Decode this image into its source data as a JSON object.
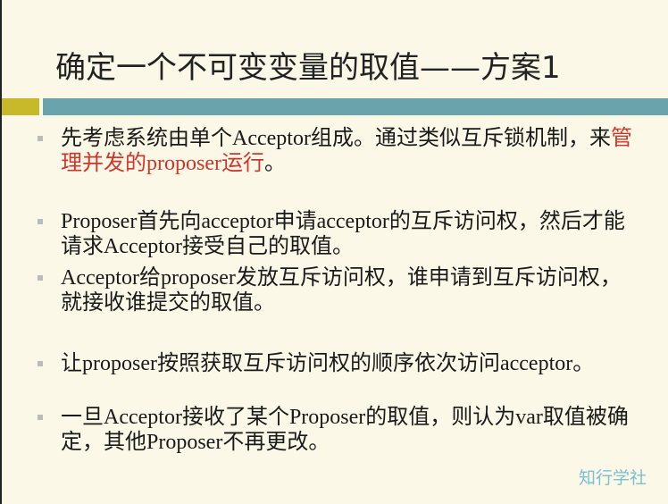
{
  "title": "确定一个不可变变量的取值——方案1",
  "bullets": [
    {
      "parts": [
        "先考虑系统由单个Acceptor组成。通过类似互斥锁机制，来",
        "管理并发的proposer运行",
        "。"
      ]
    },
    {
      "text": "Proposer首先向acceptor申请acceptor的互斥访问权，然后才能请求Acceptor接受自己的取值。"
    },
    {
      "text": "Acceptor给proposer发放互斥访问权，谁申请到互斥访问权，就接收谁提交的取值。"
    },
    {
      "text": "让proposer按照获取互斥访问权的顺序依次访问acceptor。"
    },
    {
      "text": "一旦Acceptor接收了某个Proposer的取值，则认为var取值被确定，其他Proposer不再更改。"
    }
  ],
  "watermark": "知行学社",
  "colors": {
    "accent_bar": "#6ba3ad",
    "accent_square": "#c8b92a",
    "highlight": "#d0352a",
    "background": "#fbf8e8"
  }
}
